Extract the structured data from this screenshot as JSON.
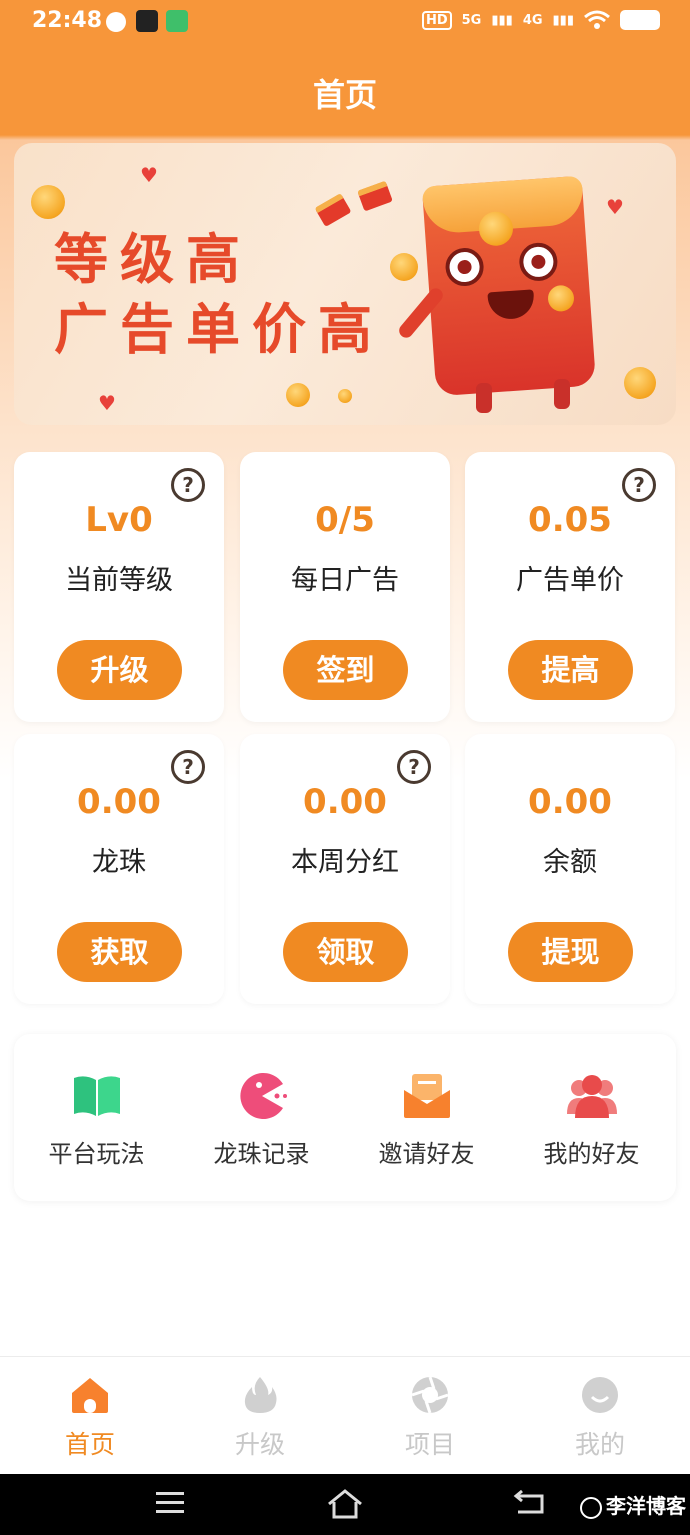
{
  "status_bar": {
    "time": "22:48",
    "indicators": [
      "HD",
      "5G",
      "4G",
      "wifi-icon",
      "battery-icon"
    ]
  },
  "header": {
    "title": "首页"
  },
  "banner": {
    "line1": "等级高",
    "line2": "广告单价高"
  },
  "stats": [
    {
      "value": "Lv0",
      "label": "当前等级",
      "button": "升级",
      "help": true
    },
    {
      "value": "0/5",
      "label": "每日广告",
      "button": "签到",
      "help": false
    },
    {
      "value": "0.05",
      "label": "广告单价",
      "button": "提高",
      "help": true
    },
    {
      "value": "0.00",
      "label": "龙珠",
      "button": "获取",
      "help": true
    },
    {
      "value": "0.00",
      "label": "本周分红",
      "button": "领取",
      "help": true
    },
    {
      "value": "0.00",
      "label": "余额",
      "button": "提现",
      "help": false
    }
  ],
  "quick_menu": [
    {
      "label": "平台玩法",
      "icon": "book-icon"
    },
    {
      "label": "龙珠记录",
      "icon": "pacman-icon"
    },
    {
      "label": "邀请好友",
      "icon": "mail-icon"
    },
    {
      "label": "我的好友",
      "icon": "friends-icon"
    }
  ],
  "bottom_nav": [
    {
      "label": "首页",
      "icon": "home-icon",
      "active": true
    },
    {
      "label": "升级",
      "icon": "flame-icon",
      "active": false
    },
    {
      "label": "项目",
      "icon": "aperture-icon",
      "active": false
    },
    {
      "label": "我的",
      "icon": "smile-icon",
      "active": false
    }
  ],
  "system_bar": {
    "watermark": "李洋博客"
  },
  "colors": {
    "accent": "#f08a22",
    "header": "#f7963a",
    "banner_text": "#e64a2a",
    "nav_inactive": "#c8c8c8"
  }
}
